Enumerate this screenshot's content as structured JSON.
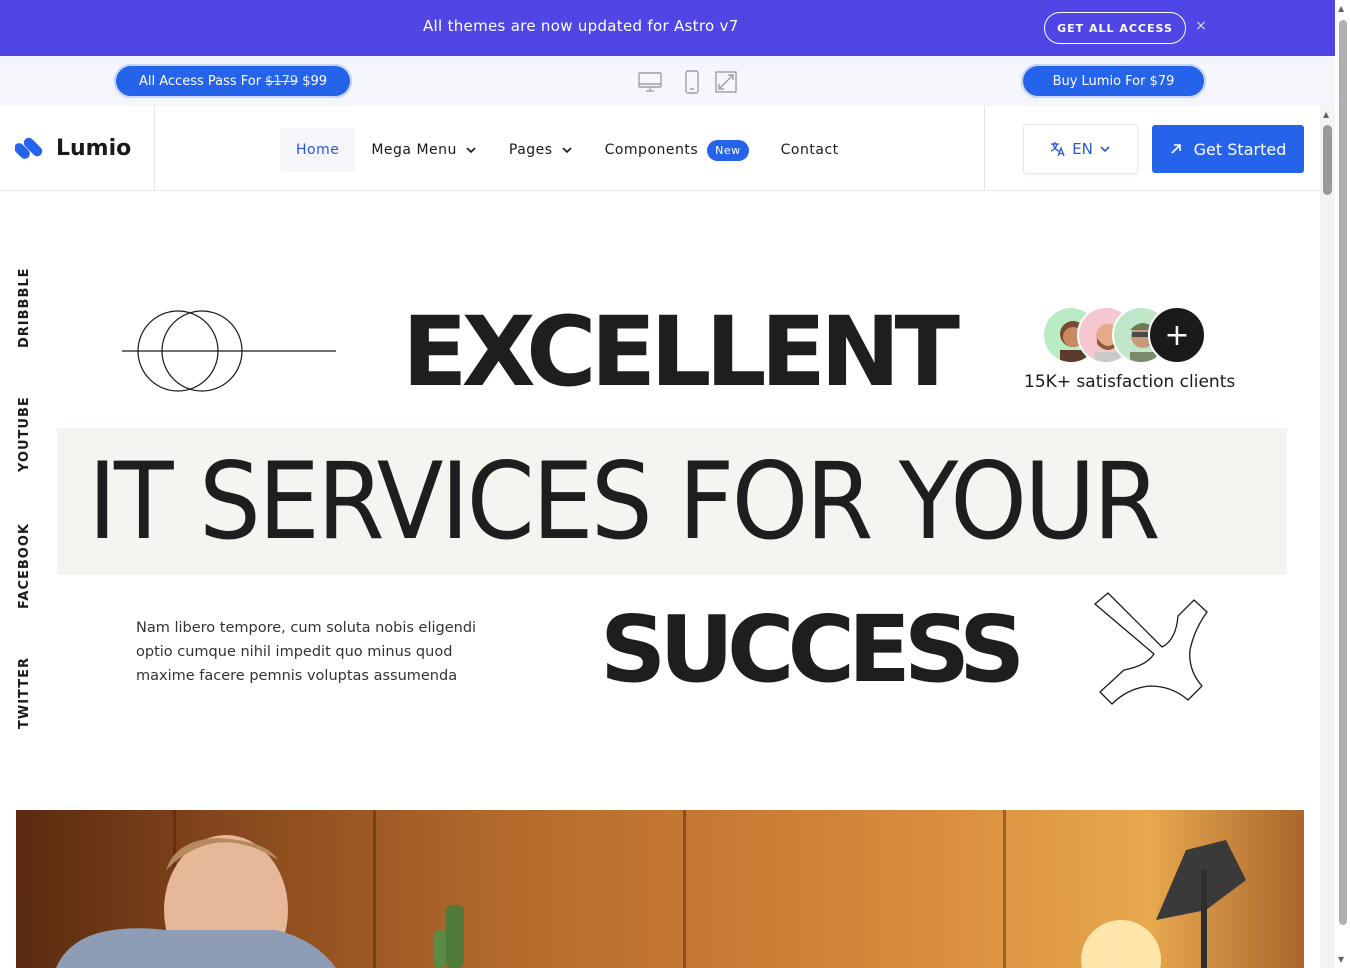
{
  "announcement": {
    "text": "All themes are now updated for Astro v7",
    "button": "GET ALL ACCESS",
    "close": "×"
  },
  "preview_bar": {
    "all_access_label": "All Access Pass For",
    "old_price": "$179",
    "new_price": "$99",
    "buy_label": "Buy Lumio For $79"
  },
  "header": {
    "logo": "Lumio",
    "nav": [
      {
        "label": "Home"
      },
      {
        "label": "Mega Menu"
      },
      {
        "label": "Pages"
      },
      {
        "label": "Components",
        "badge": "New"
      },
      {
        "label": "Contact"
      }
    ],
    "language": "EN",
    "cta": "Get Started"
  },
  "social": [
    "DRIBBBLE",
    "YOUTUBE",
    "FACEBOOK",
    "TWITTER"
  ],
  "hero": {
    "line1": "EXCELLENT",
    "line2": "IT SERVICES FOR YOUR",
    "line3": "SUCCESS",
    "paragraph": "Nam libero tempore, cum soluta nobis eligendi optio cumque nihil impedit quo minus quod maxime facere pemnis voluptas assumenda",
    "clients": "15K+  satisfaction clients",
    "plus": "+"
  },
  "colors": {
    "accent": "#2563eb",
    "announce_bg": "#4f46e5",
    "text": "#1e1e1e"
  }
}
